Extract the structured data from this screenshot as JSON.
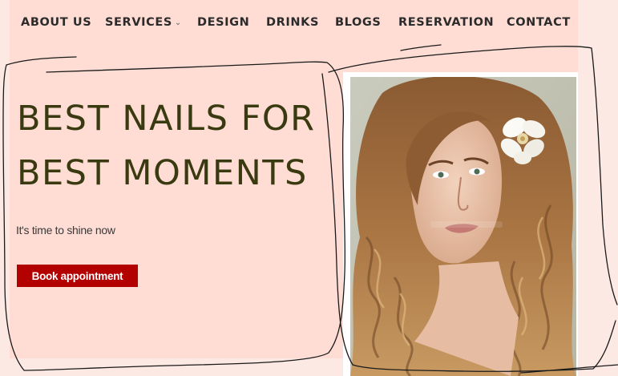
{
  "nav": {
    "items": [
      {
        "label": "ABOUT US"
      },
      {
        "label": "SERVICES"
      },
      {
        "label": "DESIGN"
      },
      {
        "label": "DRINKS"
      },
      {
        "label": "BLOGS"
      },
      {
        "label": "RESERVATION"
      },
      {
        "label": "CONTACT"
      }
    ],
    "services_chevron": "⌄"
  },
  "hero": {
    "title": "BEST NAILS FOR\nBEST MOMENTS",
    "subtitle": "It's time to shine now",
    "button_label": "Book appointment"
  },
  "colors": {
    "page_background": "#ffdcd4",
    "outer_background": "#fde9e4",
    "title_color": "#3a3a10",
    "button_color": "#b30000"
  },
  "image": {
    "icon": "woman-portrait-photo"
  }
}
